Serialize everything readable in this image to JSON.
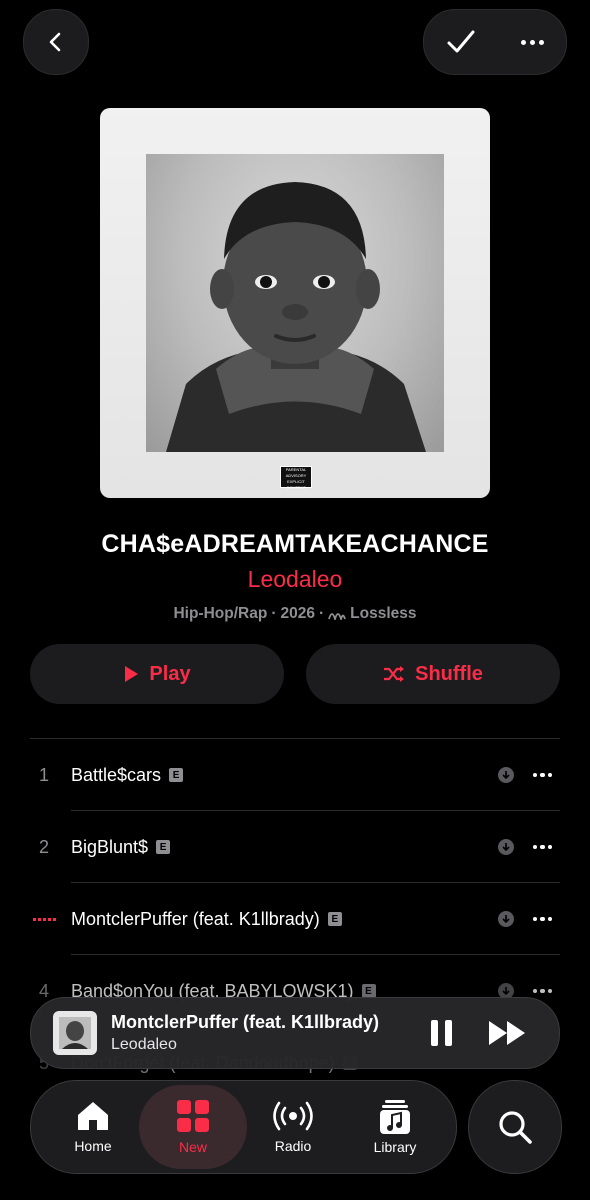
{
  "album": {
    "title": "CHA$eADREAMTAKEACHANCE",
    "artist": "Leodaleo",
    "genre": "Hip-Hop/Rap",
    "sep1": "·",
    "year": "2026",
    "sep2": "·",
    "quality": "Lossless",
    "advisory": "PARENTAL ADVISORY EXPLICIT CONTENT"
  },
  "actions": {
    "play_label": "Play",
    "shuffle_label": "Shuffle"
  },
  "tracks": [
    {
      "num": "1",
      "title": "Battle$cars",
      "explicit": "E"
    },
    {
      "num": "2",
      "title": "BigBlunt$",
      "explicit": "E"
    },
    {
      "num": "",
      "title": "MontclerPuffer (feat. K1llbrady)",
      "explicit": "E"
    },
    {
      "num": "4",
      "title": "Band$onYou (feat. BABYLOWSK1)",
      "explicit": "E"
    },
    {
      "num": "5",
      "title": "Don'tForget (feat. Dandoudhope)",
      "explicit": "E"
    }
  ],
  "now_playing": {
    "title": "MontclerPuffer (feat. K1llbrady)",
    "artist": "Leodaleo"
  },
  "tabs": [
    {
      "label": "Home",
      "icon": "house-icon"
    },
    {
      "label": "New",
      "icon": "grid-icon"
    },
    {
      "label": "Radio",
      "icon": "radio-waves-icon"
    },
    {
      "label": "Library",
      "icon": "music-note-icon"
    }
  ],
  "colors": {
    "accent": "#fa2d48",
    "background": "#000000",
    "surface": "#1c1c1e"
  }
}
